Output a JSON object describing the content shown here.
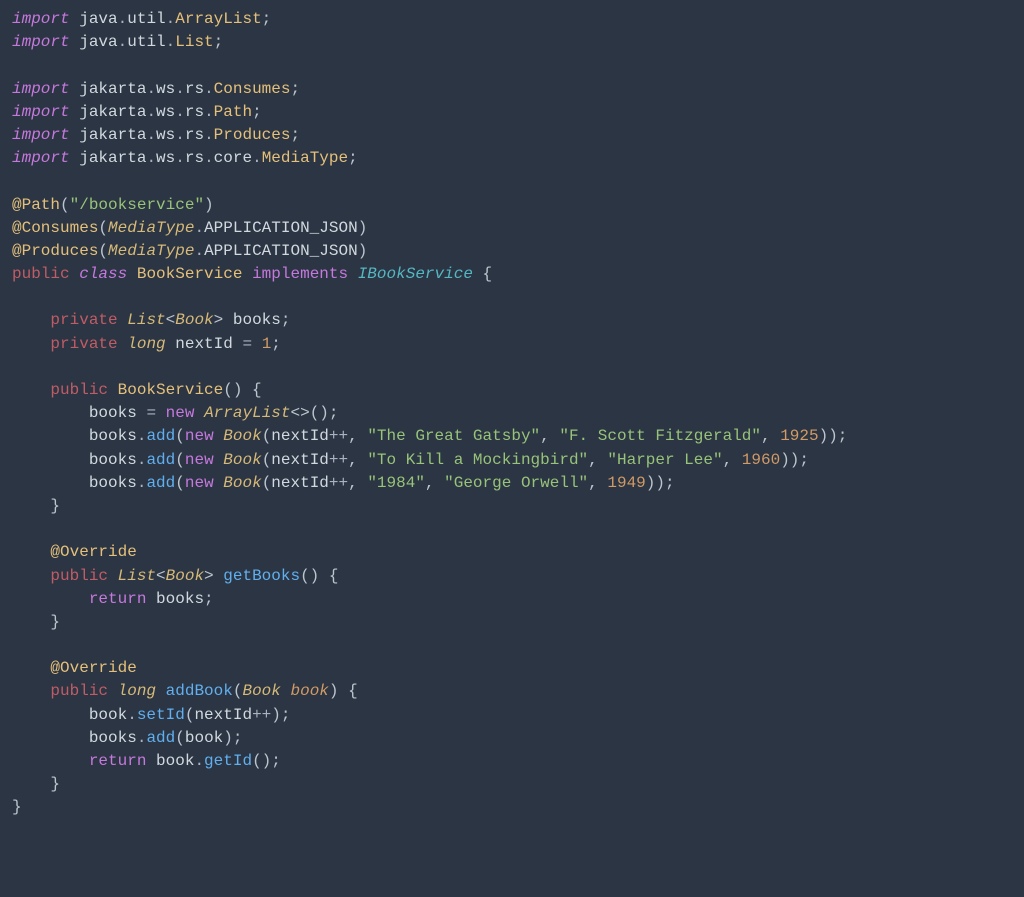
{
  "kw": {
    "import": "import",
    "public": "public",
    "private": "private",
    "class": "class",
    "implements": "implements",
    "new": "new",
    "return": "return"
  },
  "l1": {
    "p1": "java",
    "p2": "util",
    "cls": "ArrayList"
  },
  "l2": {
    "p1": "java",
    "p2": "util",
    "cls": "List"
  },
  "l3": {
    "p1": "jakarta",
    "p2": "ws",
    "p3": "rs",
    "cls": "Consumes"
  },
  "l4": {
    "p1": "jakarta",
    "p2": "ws",
    "p3": "rs",
    "cls": "Path"
  },
  "l5": {
    "p1": "jakarta",
    "p2": "ws",
    "p3": "rs",
    "cls": "Produces"
  },
  "l6": {
    "p1": "jakarta",
    "p2": "ws",
    "p3": "rs",
    "p4": "core",
    "cls": "MediaType"
  },
  "ann": {
    "path": "@Path",
    "pathArg": "\"/bookservice\"",
    "consumes": "@Consumes",
    "produces": "@Produces",
    "mediaType": "MediaType",
    "appJson": "APPLICATION_JSON",
    "override": "@Override"
  },
  "cls": {
    "name": "BookService",
    "iface": "IBookService"
  },
  "fld": {
    "listType": "List",
    "bookType": "Book",
    "books": "books",
    "longType": "long",
    "nextId": "nextId",
    "nextIdVal": "1"
  },
  "ctor": {
    "name": "BookService",
    "arrayList": "ArrayList"
  },
  "m": {
    "add": "add",
    "getBooks": "getBooks",
    "addBook": "addBook",
    "setId": "setId",
    "getId": "getId"
  },
  "p": {
    "book": "book"
  },
  "b1": {
    "title": "\"The Great Gatsby\"",
    "author": "\"F. Scott Fitzgerald\"",
    "year": "1925"
  },
  "b2": {
    "title": "\"To Kill a Mockingbird\"",
    "author": "\"Harper Lee\"",
    "year": "1960"
  },
  "b3": {
    "title": "\"1984\"",
    "author": "\"George Orwell\"",
    "year": "1949"
  }
}
